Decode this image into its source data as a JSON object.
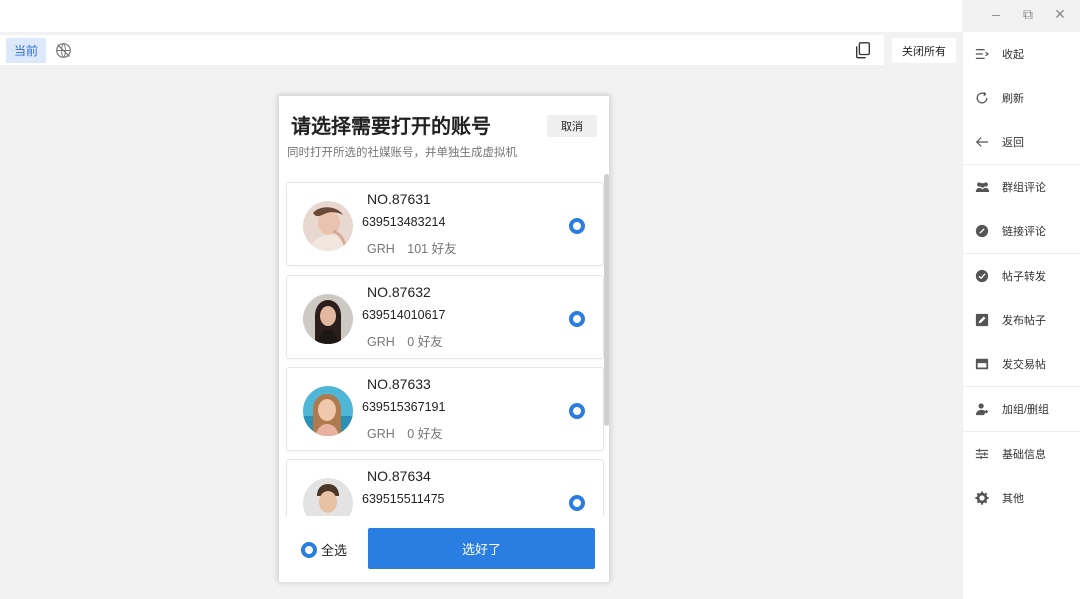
{
  "window": {
    "controls": {
      "minimize": "–",
      "restore": "⧉",
      "close": "✕"
    }
  },
  "toolbar": {
    "current_tab": "当前",
    "close_all": "关闭所有"
  },
  "sidebar": {
    "items": [
      {
        "label": "收起",
        "icon": "collapse-icon"
      },
      {
        "label": "刷新",
        "icon": "refresh-icon"
      },
      {
        "label": "返回",
        "icon": "back-arrow-icon"
      },
      {
        "label": "群组评论",
        "icon": "group-icon"
      },
      {
        "label": "链接评论",
        "icon": "link-icon"
      },
      {
        "label": "帖子转发",
        "icon": "forward-icon"
      },
      {
        "label": "发布帖子",
        "icon": "edit-icon"
      },
      {
        "label": "发交易帖",
        "icon": "store-icon"
      },
      {
        "label": "加组/删组",
        "icon": "user-group-icon"
      },
      {
        "label": "基础信息",
        "icon": "sliders-icon"
      },
      {
        "label": "其他",
        "icon": "gear-icon"
      }
    ]
  },
  "modal": {
    "title": "请选择需要打开的账号",
    "subtitle": "同时打开所选的社媒账号，并单独生成虚拟机",
    "cancel": "取消",
    "accounts": [
      {
        "no": "NO.87631",
        "phone": "639513483214",
        "meta": "GRH　101 好友",
        "selected": true
      },
      {
        "no": "NO.87632",
        "phone": "639514010617",
        "meta": "GRH　0 好友",
        "selected": true
      },
      {
        "no": "NO.87633",
        "phone": "639515367191",
        "meta": "GRH　0 好友",
        "selected": true
      },
      {
        "no": "NO.87634",
        "phone": "639515511475",
        "meta": "",
        "selected": true
      }
    ],
    "select_all": "全选",
    "confirm": "选好了"
  },
  "colors": {
    "accent": "#2a7de1",
    "tab_bg": "#dde9fb"
  }
}
